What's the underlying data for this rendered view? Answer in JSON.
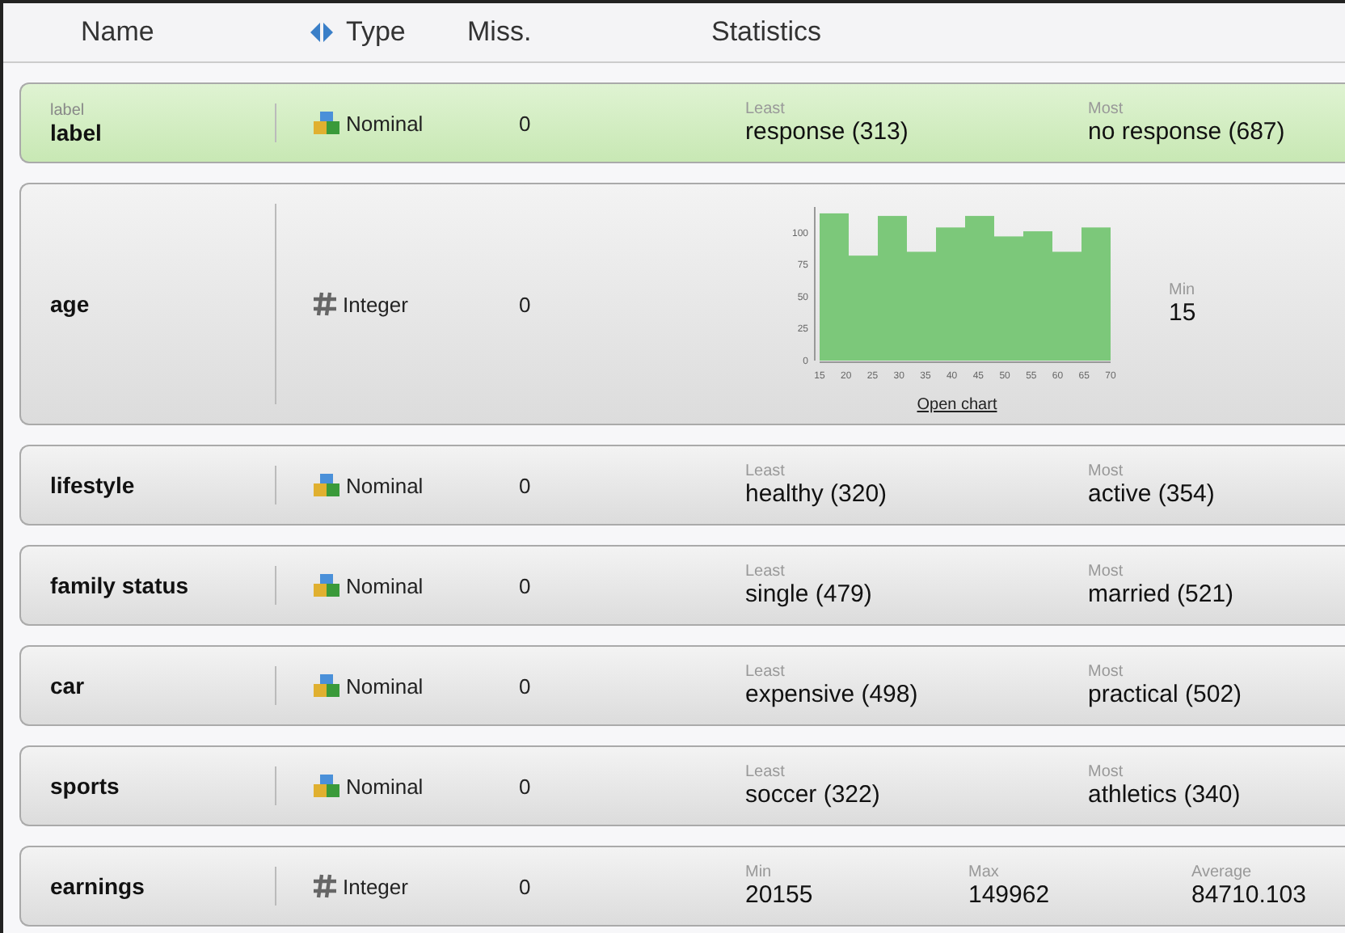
{
  "header": {
    "columns": [
      {
        "label": "Name",
        "kind": "text"
      },
      {
        "label": "Type",
        "kind": "sortable"
      },
      {
        "label": "Miss.",
        "kind": "text"
      },
      {
        "label": "Statistics",
        "kind": "text"
      }
    ]
  },
  "rows": [
    {
      "name": "label",
      "role": "label",
      "type": "Nominal",
      "kind": "nominal",
      "missing": "0",
      "selected": true,
      "stats": [
        {
          "label": "Least",
          "value": "response (313)"
        },
        {
          "label": "Most",
          "value": "no response (687)"
        }
      ]
    },
    {
      "name": "age",
      "type": "Integer",
      "kind": "integer",
      "missing": "0",
      "selected": false,
      "chart_data": {
        "type": "bar",
        "x": [
          17.75,
          23.25,
          28.75,
          34.25,
          39.75,
          45.25,
          50.75,
          56.25,
          61.75,
          67.25
        ],
        "values": [
          115,
          82,
          113,
          85,
          104,
          113,
          97,
          101,
          85,
          104
        ],
        "xlim": [
          15,
          70
        ],
        "ylim": [
          0,
          120
        ],
        "xticks": [
          15,
          20,
          25,
          30,
          35,
          40,
          45,
          50,
          55,
          60,
          65,
          70
        ],
        "yticks": [
          0,
          25,
          50,
          75,
          100
        ]
      },
      "link": "Open chart",
      "stats": [
        {
          "label": "Min",
          "value": "15"
        }
      ]
    },
    {
      "name": "lifestyle",
      "type": "Nominal",
      "kind": "nominal",
      "missing": "0",
      "selected": false,
      "stats": [
        {
          "label": "Least",
          "value": "healthy (320)"
        },
        {
          "label": "Most",
          "value": "active (354)"
        }
      ]
    },
    {
      "name": "family status",
      "type": "Nominal",
      "kind": "nominal",
      "missing": "0",
      "selected": false,
      "stats": [
        {
          "label": "Least",
          "value": "single (479)"
        },
        {
          "label": "Most",
          "value": "married (521)"
        }
      ]
    },
    {
      "name": "car",
      "type": "Nominal",
      "kind": "nominal",
      "missing": "0",
      "selected": false,
      "stats": [
        {
          "label": "Least",
          "value": "expensive (498)"
        },
        {
          "label": "Most",
          "value": "practical (502)"
        }
      ]
    },
    {
      "name": "sports",
      "type": "Nominal",
      "kind": "nominal",
      "missing": "0",
      "selected": false,
      "stats": [
        {
          "label": "Least",
          "value": "soccer (322)"
        },
        {
          "label": "Most",
          "value": "athletics (340)"
        }
      ]
    },
    {
      "name": "earnings",
      "type": "Integer",
      "kind": "integer",
      "missing": "0",
      "selected": false,
      "stats": [
        {
          "label": "Min",
          "value": "20155"
        },
        {
          "label": "Max",
          "value": "149962"
        },
        {
          "label": "Average",
          "value": "84710.103"
        }
      ]
    }
  ]
}
